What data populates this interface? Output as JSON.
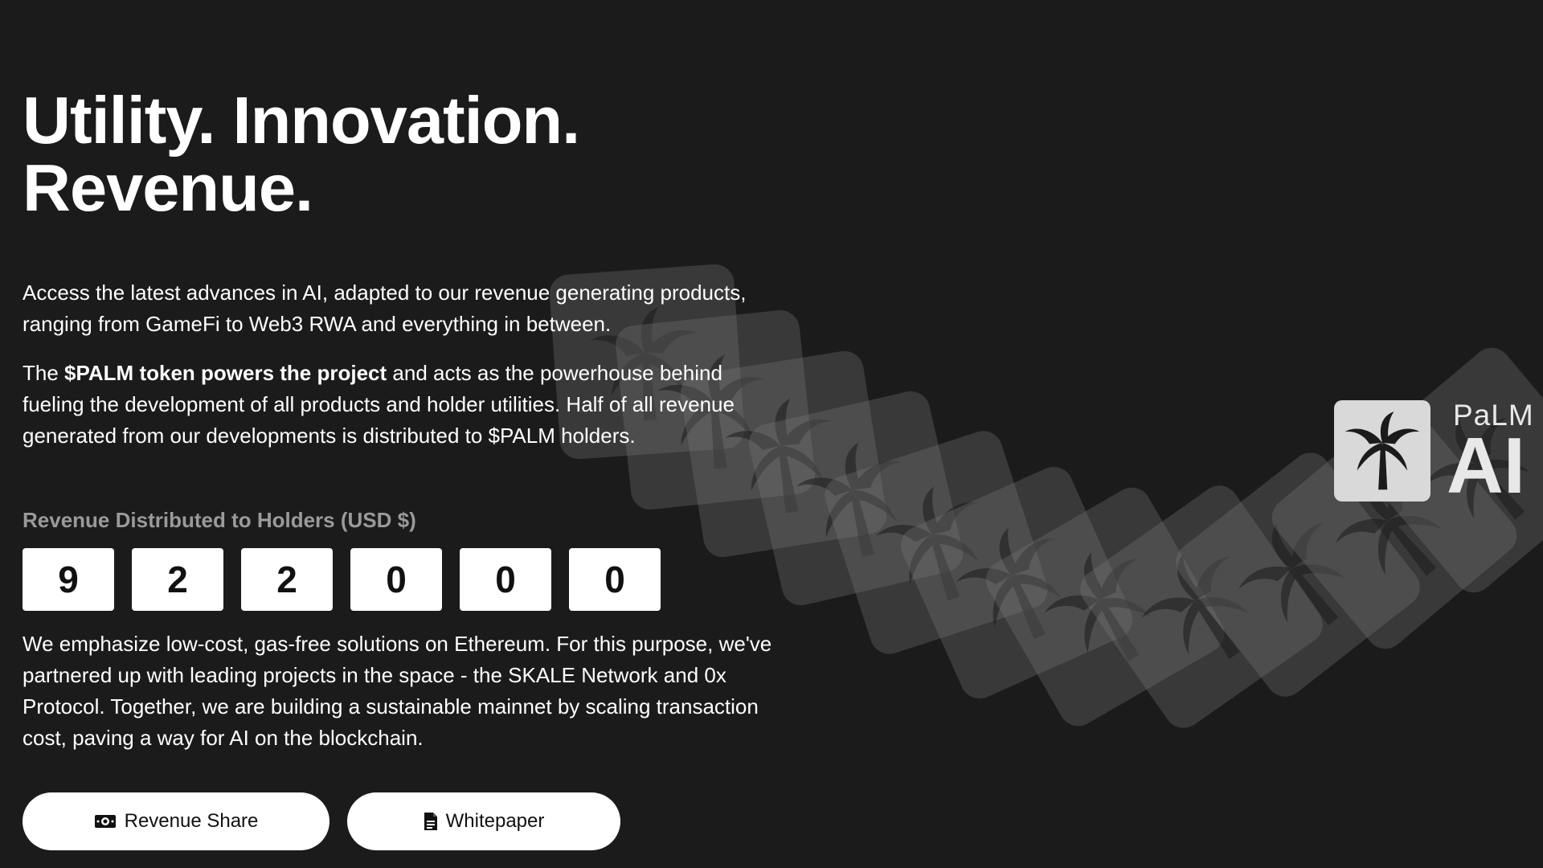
{
  "hero": {
    "headline_line1": "Utility. Innovation.",
    "headline_line2": "Revenue.",
    "paragraph1": "Access the latest advances in AI, adapted to our revenue generating products, ranging from GameFi to Web3 RWA and everything in between.",
    "paragraph2_prefix": "The ",
    "paragraph2_bold": "$PALM token powers the project",
    "paragraph2_suffix": " and acts as the powerhouse behind fueling the development of all products and holder utilities. Half of all revenue generated from our developments is distributed to $PALM holders.",
    "revenue_label": "Revenue Distributed to Holders (USD $)",
    "revenue_digits": [
      "9",
      "2",
      "2",
      "0",
      "0",
      "0"
    ],
    "paragraph3": "We emphasize low-cost, gas-free solutions on Ethereum. For this purpose, we've partnered up with leading projects in the space - the SKALE Network and 0x Protocol. Together, we are building a sustainable mainnet by scaling transaction cost, paving a way for AI on the blockchain."
  },
  "buttons": {
    "revenue_share": {
      "label": "Revenue Share",
      "icon": "money-icon"
    },
    "whitepaper": {
      "label": "Whitepaper",
      "icon": "document-icon"
    }
  },
  "logo": {
    "small_text": "PaLM",
    "big_text": "AI",
    "icon": "palm-tree-icon"
  },
  "colors": {
    "background": "#1b1b1b",
    "text": "#ffffff",
    "muted_label": "#9a9a9a",
    "button_bg": "#ffffff"
  }
}
